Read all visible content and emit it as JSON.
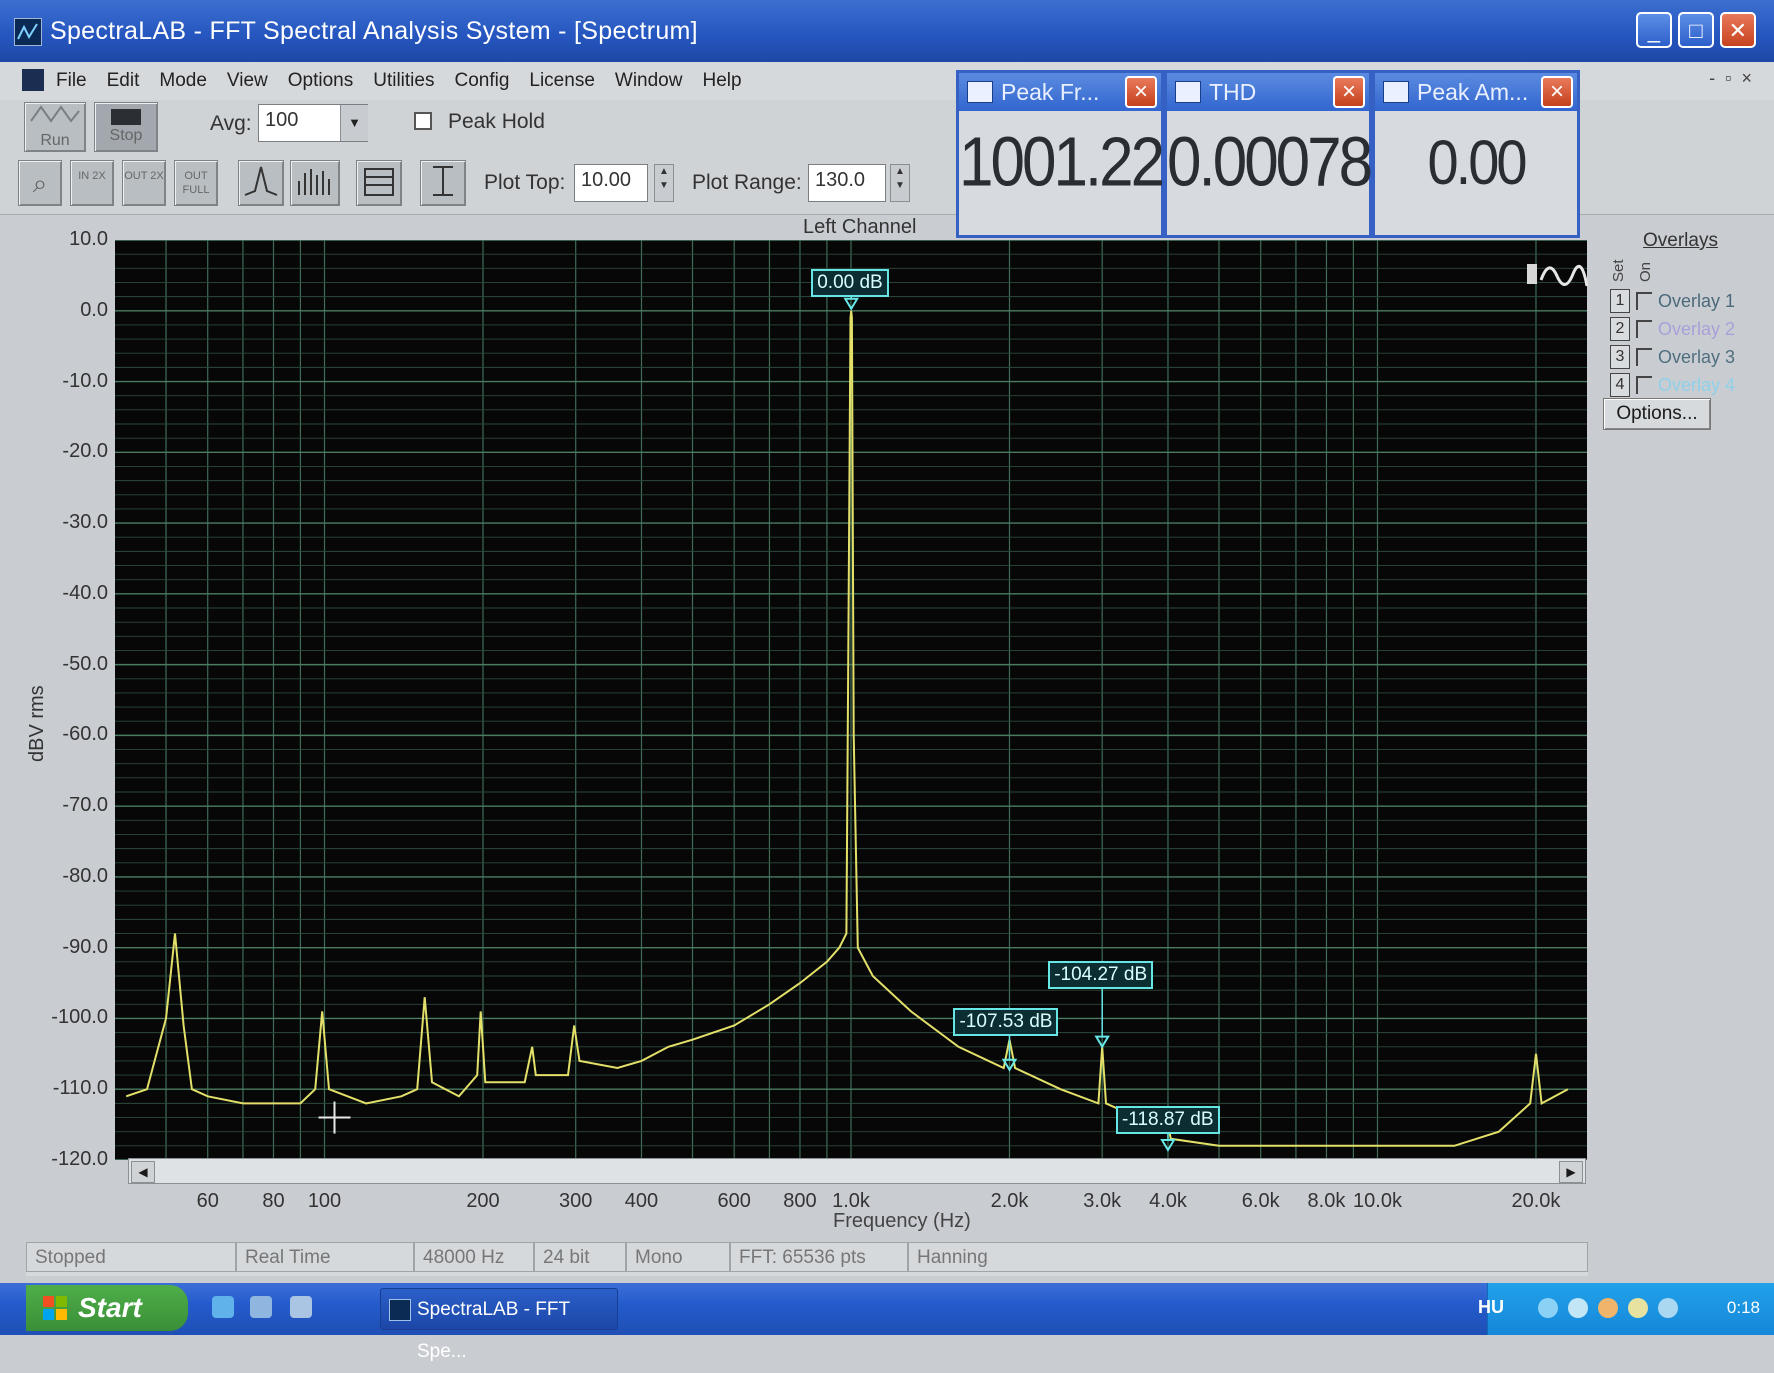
{
  "window": {
    "title": "SpectraLAB - FFT Spectral Analysis System - [Spectrum]",
    "minimize": "_",
    "maximize": "□",
    "close": "✕"
  },
  "menu": [
    "File",
    "Edit",
    "Mode",
    "View",
    "Options",
    "Utilities",
    "Config",
    "License",
    "Window",
    "Help"
  ],
  "mdi_buttons": [
    "-",
    "▫",
    "×"
  ],
  "toolbar": {
    "run_label": "Run",
    "stop_label": "Stop",
    "avg_label": "Avg:",
    "avg_value": "100",
    "peak_hold_label": "Peak Hold",
    "zoom_in_label": "IN 2X",
    "zoom_out_label": "OUT 2X",
    "zoom_full_label": "OUT FULL",
    "plot_top_label": "Plot Top:",
    "plot_top_value": "10.00",
    "plot_range_label": "Plot Range:",
    "plot_range_value": "130.0"
  },
  "meters": [
    {
      "title": "Peak Fr...",
      "value": "1001.22 Hz"
    },
    {
      "title": "THD",
      "value": "0.00078 %"
    },
    {
      "title": "Peak Am...",
      "value": "0.00 dBV rms"
    }
  ],
  "plot": {
    "channel": "Left Channel",
    "markers": [
      "0.00 dB",
      "-107.53 dB",
      "-104.27 dB",
      "-118.87 dB"
    ]
  },
  "overlays": {
    "title": "Overlays",
    "set_label": "Set",
    "on_label": "On",
    "items": [
      {
        "num": "1",
        "label": "Overlay 1",
        "color": "#4a6a7a"
      },
      {
        "num": "2",
        "label": "Overlay 2",
        "color": "#a8a0d8"
      },
      {
        "num": "3",
        "label": "Overlay 3",
        "color": "#4f6f7f"
      },
      {
        "num": "4",
        "label": "Overlay 4",
        "color": "#8fd0e8"
      }
    ],
    "options_label": "Options..."
  },
  "status": [
    "Stopped",
    "Real Time",
    "48000 Hz",
    "24 bit",
    "Mono",
    "FFT: 65536 pts",
    "Hanning"
  ],
  "taskbar": {
    "start_label": "Start",
    "task_label": "SpectraLAB - FFT Spe...",
    "lang": "HU",
    "clock": "0:18"
  },
  "chart_data": {
    "type": "line",
    "title": "Left Channel",
    "xlabel": "Frequency (Hz)",
    "ylabel": "dBV rms",
    "x_scale": "log",
    "xlim": [
      40,
      25000
    ],
    "ylim": [
      -120,
      10
    ],
    "grid": true,
    "y_ticks": [
      "10.0",
      "0.0",
      "-10.0",
      "-20.0",
      "-30.0",
      "-40.0",
      "-50.0",
      "-60.0",
      "-70.0",
      "-80.0",
      "-90.0",
      "-100.0",
      "-110.0",
      "-120.0"
    ],
    "x_ticks": [
      {
        "value": 60,
        "label": "60"
      },
      {
        "value": 80,
        "label": "80"
      },
      {
        "value": 100,
        "label": "100"
      },
      {
        "value": 200,
        "label": "200"
      },
      {
        "value": 300,
        "label": "300"
      },
      {
        "value": 400,
        "label": "400"
      },
      {
        "value": 600,
        "label": "600"
      },
      {
        "value": 800,
        "label": "800"
      },
      {
        "value": 1000,
        "label": "1.0k"
      },
      {
        "value": 2000,
        "label": "2.0k"
      },
      {
        "value": 3000,
        "label": "3.0k"
      },
      {
        "value": 4000,
        "label": "4.0k"
      },
      {
        "value": 6000,
        "label": "6.0k"
      },
      {
        "value": 8000,
        "label": "8.0k"
      },
      {
        "value": 10000,
        "label": "10.0k"
      },
      {
        "value": 20000,
        "label": "20.0k"
      }
    ],
    "series": [
      {
        "color": "#e3e06a",
        "points": [
          [
            42,
            -111
          ],
          [
            46,
            -110
          ],
          [
            50,
            -100
          ],
          [
            52,
            -88
          ],
          [
            54,
            -101
          ],
          [
            56,
            -110
          ],
          [
            60,
            -111
          ],
          [
            70,
            -112
          ],
          [
            80,
            -112
          ],
          [
            90,
            -112
          ],
          [
            96,
            -110
          ],
          [
            99,
            -99
          ],
          [
            102,
            -110
          ],
          [
            120,
            -112
          ],
          [
            140,
            -111
          ],
          [
            150,
            -110
          ],
          [
            155,
            -97
          ],
          [
            160,
            -109
          ],
          [
            180,
            -111
          ],
          [
            195,
            -108
          ],
          [
            198,
            -99
          ],
          [
            202,
            -109
          ],
          [
            240,
            -109
          ],
          [
            248,
            -104
          ],
          [
            252,
            -108
          ],
          [
            290,
            -108
          ],
          [
            298,
            -101
          ],
          [
            305,
            -106
          ],
          [
            360,
            -107
          ],
          [
            400,
            -106
          ],
          [
            450,
            -104
          ],
          [
            500,
            -103
          ],
          [
            600,
            -101
          ],
          [
            700,
            -98
          ],
          [
            800,
            -95
          ],
          [
            900,
            -92
          ],
          [
            950,
            -90
          ],
          [
            980,
            -88
          ],
          [
            990,
            -40
          ],
          [
            998,
            -1
          ],
          [
            1001,
            0
          ],
          [
            1004,
            -1
          ],
          [
            1012,
            -60
          ],
          [
            1030,
            -90
          ],
          [
            1100,
            -94
          ],
          [
            1300,
            -99
          ],
          [
            1600,
            -104
          ],
          [
            1950,
            -107
          ],
          [
            2000,
            -103
          ],
          [
            2050,
            -107
          ],
          [
            2500,
            -110
          ],
          [
            2950,
            -112
          ],
          [
            3000,
            -104
          ],
          [
            3050,
            -112
          ],
          [
            3500,
            -114
          ],
          [
            3950,
            -116
          ],
          [
            4000,
            -115
          ],
          [
            4050,
            -117
          ],
          [
            5000,
            -118
          ],
          [
            7000,
            -118
          ],
          [
            10000,
            -118
          ],
          [
            14000,
            -118
          ],
          [
            17000,
            -116
          ],
          [
            19500,
            -112
          ],
          [
            20000,
            -105
          ],
          [
            20500,
            -112
          ],
          [
            23000,
            -110
          ]
        ]
      }
    ],
    "peaks": [
      {
        "freq": 1001,
        "value": 0.0,
        "label": "0.00 dB"
      },
      {
        "freq": 2000,
        "value": -107.53,
        "label": "-107.53 dB"
      },
      {
        "freq": 3000,
        "value": -104.27,
        "label": "-104.27 dB"
      },
      {
        "freq": 4000,
        "value": -118.87,
        "label": "-118.87 dB"
      }
    ]
  }
}
